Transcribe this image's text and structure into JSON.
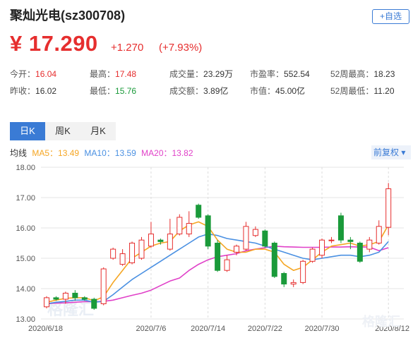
{
  "stock": {
    "title": "聚灿光电(sz300708)",
    "add_button": "+自选",
    "price": "¥ 17.290",
    "change": "+1.270",
    "change_pct": "(+7.93%)"
  },
  "stats": {
    "open_label": "今开：",
    "open": "16.04",
    "high_label": "最高：",
    "high": "17.48",
    "volume_label": "成交量：",
    "volume": "23.29万",
    "pe_label": "市盈率：",
    "pe": "552.54",
    "w52high_label": "52周最高：",
    "w52high": "18.23",
    "prevclose_label": "昨收：",
    "prevclose": "16.02",
    "low_label": "最低：",
    "low": "15.76",
    "turnover_label": "成交额：",
    "turnover": "3.89亿",
    "mktcap_label": "市值：",
    "mktcap": "45.00亿",
    "w52low_label": "52周最低：",
    "w52low": "11.20"
  },
  "tabs": [
    "日K",
    "周K",
    "月K"
  ],
  "ma": {
    "label": "均线",
    "ma5": "MA5：13.49",
    "ma10": "MA10：13.59",
    "ma20": "MA20：13.82",
    "restore": "前复权 ▾"
  },
  "colors": {
    "up": "#e62e2e",
    "down": "#1a9a3a",
    "ma5": "#f5a623",
    "ma10": "#4a90e2",
    "ma20": "#e040c8",
    "accent": "#3a7bd5"
  },
  "watermark": "格隆汇",
  "chart_data": {
    "type": "candlestick",
    "y_ticks": [
      "18.00",
      "17.00",
      "16.00",
      "15.00",
      "14.00",
      "13.00"
    ],
    "ylim": [
      13.0,
      18.0
    ],
    "x_ticks": [
      {
        "index": 0,
        "label": "2020/6/18"
      },
      {
        "index": 11,
        "label": "2020/7/6"
      },
      {
        "index": 17,
        "label": "2020/7/14"
      },
      {
        "index": 23,
        "label": "2020/7/22"
      },
      {
        "index": 29,
        "label": "2020/7/30"
      },
      {
        "index": 36,
        "label": "2020/8/12"
      }
    ],
    "candles": [
      {
        "o": 13.4,
        "c": 13.7,
        "h": 13.75,
        "l": 13.35
      },
      {
        "o": 13.7,
        "c": 13.65,
        "h": 13.75,
        "l": 13.6
      },
      {
        "o": 13.65,
        "c": 13.85,
        "h": 13.9,
        "l": 13.5
      },
      {
        "o": 13.85,
        "c": 13.7,
        "h": 13.95,
        "l": 13.6
      },
      {
        "o": 13.7,
        "c": 13.65,
        "h": 13.75,
        "l": 13.6
      },
      {
        "o": 13.65,
        "c": 13.35,
        "h": 13.7,
        "l": 13.3
      },
      {
        "o": 13.5,
        "c": 14.65,
        "h": 14.7,
        "l": 13.45
      },
      {
        "o": 15.0,
        "c": 15.3,
        "h": 15.35,
        "l": 14.95
      },
      {
        "o": 14.8,
        "c": 15.15,
        "h": 15.3,
        "l": 14.75
      },
      {
        "o": 14.85,
        "c": 15.5,
        "h": 15.55,
        "l": 14.8
      },
      {
        "o": 15.0,
        "c": 15.6,
        "h": 15.7,
        "l": 14.95
      },
      {
        "o": 15.4,
        "c": 15.8,
        "h": 16.2,
        "l": 15.35
      },
      {
        "o": 15.6,
        "c": 15.55,
        "h": 15.65,
        "l": 15.45
      },
      {
        "o": 15.3,
        "c": 15.8,
        "h": 16.3,
        "l": 15.25
      },
      {
        "o": 15.8,
        "c": 16.35,
        "h": 16.45,
        "l": 15.75
      },
      {
        "o": 15.8,
        "c": 16.15,
        "h": 16.55,
        "l": 15.7
      },
      {
        "o": 16.75,
        "c": 16.35,
        "h": 16.8,
        "l": 16.3
      },
      {
        "o": 16.4,
        "c": 15.4,
        "h": 16.45,
        "l": 15.3
      },
      {
        "o": 15.5,
        "c": 14.6,
        "h": 15.6,
        "l": 14.55
      },
      {
        "o": 14.6,
        "c": 14.95,
        "h": 15.1,
        "l": 14.55
      },
      {
        "o": 15.2,
        "c": 15.4,
        "h": 15.45,
        "l": 15.1
      },
      {
        "o": 15.3,
        "c": 16.05,
        "h": 16.2,
        "l": 15.25
      },
      {
        "o": 15.75,
        "c": 15.95,
        "h": 16.05,
        "l": 15.7
      },
      {
        "o": 15.9,
        "c": 15.4,
        "h": 15.95,
        "l": 15.35
      },
      {
        "o": 15.5,
        "c": 14.4,
        "h": 15.55,
        "l": 14.35
      },
      {
        "o": 14.5,
        "c": 14.15,
        "h": 14.55,
        "l": 14.05
      },
      {
        "o": 14.15,
        "c": 14.2,
        "h": 14.3,
        "l": 14.05
      },
      {
        "o": 14.2,
        "c": 14.9,
        "h": 14.95,
        "l": 14.15
      },
      {
        "o": 14.9,
        "c": 15.3,
        "h": 15.35,
        "l": 14.85
      },
      {
        "o": 15.1,
        "c": 15.6,
        "h": 15.65,
        "l": 15.0
      },
      {
        "o": 15.6,
        "c": 15.6,
        "h": 15.7,
        "l": 15.5
      },
      {
        "o": 16.4,
        "c": 15.6,
        "h": 16.5,
        "l": 15.5
      },
      {
        "o": 15.6,
        "c": 15.55,
        "h": 15.7,
        "l": 15.3
      },
      {
        "o": 15.5,
        "c": 14.9,
        "h": 15.55,
        "l": 14.85
      },
      {
        "o": 15.3,
        "c": 15.6,
        "h": 15.7,
        "l": 15.2
      },
      {
        "o": 15.5,
        "c": 16.05,
        "h": 16.25,
        "l": 15.45
      },
      {
        "o": 16.02,
        "c": 17.29,
        "h": 17.48,
        "l": 15.76
      }
    ],
    "ma5": [
      13.55,
      13.62,
      13.68,
      13.7,
      13.7,
      13.6,
      13.73,
      14.2,
      14.6,
      15.0,
      15.2,
      15.4,
      15.5,
      15.55,
      15.9,
      16.1,
      16.2,
      16.05,
      15.6,
      15.3,
      15.2,
      15.2,
      15.3,
      15.3,
      15.2,
      14.8,
      14.6,
      14.7,
      14.95,
      15.2,
      15.4,
      15.45,
      15.5,
      15.4,
      15.45,
      15.55,
      16.1
    ],
    "ma10": [
      13.5,
      13.55,
      13.58,
      13.62,
      13.62,
      13.55,
      13.58,
      13.8,
      14.05,
      14.3,
      14.5,
      14.7,
      14.9,
      15.1,
      15.3,
      15.5,
      15.7,
      15.8,
      15.75,
      15.65,
      15.6,
      15.55,
      15.5,
      15.4,
      15.3,
      15.2,
      15.1,
      15.0,
      14.95,
      15.0,
      15.05,
      15.1,
      15.1,
      15.05,
      15.1,
      15.2,
      15.55
    ],
    "ma20": [
      13.5,
      13.52,
      13.53,
      13.55,
      13.57,
      13.57,
      13.58,
      13.62,
      13.7,
      13.78,
      13.85,
      13.95,
      14.1,
      14.25,
      14.35,
      14.6,
      14.8,
      14.95,
      15.05,
      15.1,
      15.15,
      15.25,
      15.3,
      15.35,
      15.4,
      15.38,
      15.37,
      15.36,
      15.36,
      15.36,
      15.37,
      15.37,
      15.38,
      15.37,
      15.37,
      15.25,
      15.35
    ]
  }
}
